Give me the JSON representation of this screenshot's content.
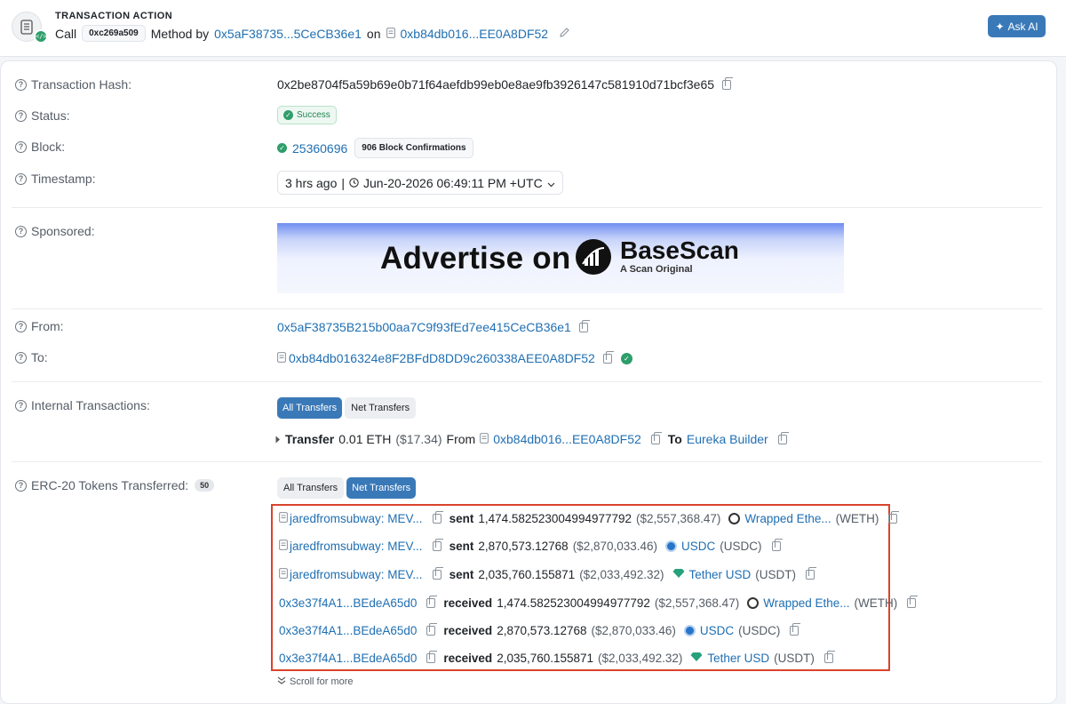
{
  "header": {
    "title": "TRANSACTION ACTION",
    "call_label": "Call",
    "method_id": "0xc269a509",
    "method_by_label": "Method by",
    "method_by_address": "0x5aF38735...5CeCB36e1",
    "on_label": "on",
    "contract_address": "0xb84db016...EE0A8DF52",
    "ask_ai_label": "Ask AI"
  },
  "details": {
    "tx_hash_label": "Transaction Hash:",
    "tx_hash": "0x2be8704f5a59b69e0b71f64aefdb99eb0e8ae9fb3926147c581910d71bcf3e65",
    "status_label": "Status:",
    "status": "Success",
    "block_label": "Block:",
    "block_number": "25360696",
    "block_confirmations": "906 Block Confirmations",
    "timestamp_label": "Timestamp:",
    "timestamp_relative": "3 hrs ago",
    "timestamp_sep": "|",
    "timestamp_full": "Jun-20-2026 06:49:11 PM +UTC",
    "sponsored_label": "Sponsored:",
    "ad_text": "Advertise on",
    "ad_brand": "BaseScan",
    "ad_sub": "A Scan Original",
    "from_label": "From:",
    "from_address": "0x5aF38735B215b00aa7C9f93fEd7ee415CeCB36e1",
    "to_label": "To:",
    "to_address": "0xb84db016324e8F2BFdD8DD9c260338AEE0A8DF52",
    "internal_label": "Internal Transactions:",
    "all_transfers_label": "All Transfers",
    "net_transfers_label": "Net Transfers",
    "internal_transfer": {
      "label": "Transfer",
      "amount": "0.01 ETH",
      "usd": "($17.34)",
      "from_label": "From",
      "from": "0xb84db016...EE0A8DF52",
      "to_label": "To",
      "to": "Eureka Builder"
    },
    "erc20_label": "ERC-20 Tokens Transferred:",
    "erc20_count": "50",
    "scroll_more": "Scroll for more"
  },
  "token_transfers": [
    {
      "party": "jaredfromsubway: MEV...",
      "action": "sent",
      "amount": "1,474.582523004994977792",
      "usd": "($2,557,368.47)",
      "token": "Wrapped Ethe...",
      "symbol": "(WETH)"
    },
    {
      "party": "jaredfromsubway: MEV...",
      "action": "sent",
      "amount": "2,870,573.12768",
      "usd": "($2,870,033.46)",
      "token": "USDC",
      "symbol": "(USDC)"
    },
    {
      "party": "jaredfromsubway: MEV...",
      "action": "sent",
      "amount": "2,035,760.155871",
      "usd": "($2,033,492.32)",
      "token": "Tether USD",
      "symbol": "(USDT)"
    },
    {
      "party": "0x3e37f4A1...BEdeA65d0",
      "action": "received",
      "amount": "1,474.582523004994977792",
      "usd": "($2,557,368.47)",
      "token": "Wrapped Ethe...",
      "symbol": "(WETH)"
    },
    {
      "party": "0x3e37f4A1...BEdeA65d0",
      "action": "received",
      "amount": "2,870,573.12768",
      "usd": "($2,870,033.46)",
      "token": "USDC",
      "symbol": "(USDC)"
    },
    {
      "party": "0x3e37f4A1...BEdeA65d0",
      "action": "received",
      "amount": "2,035,760.155871",
      "usd": "($2,033,492.32)",
      "token": "Tether USD",
      "symbol": "(USDT)"
    }
  ],
  "colors": {
    "link": "#1f6fb2",
    "accent": "#3a79b8",
    "success": "#2e9e6a",
    "highlight": "#d9432c"
  }
}
